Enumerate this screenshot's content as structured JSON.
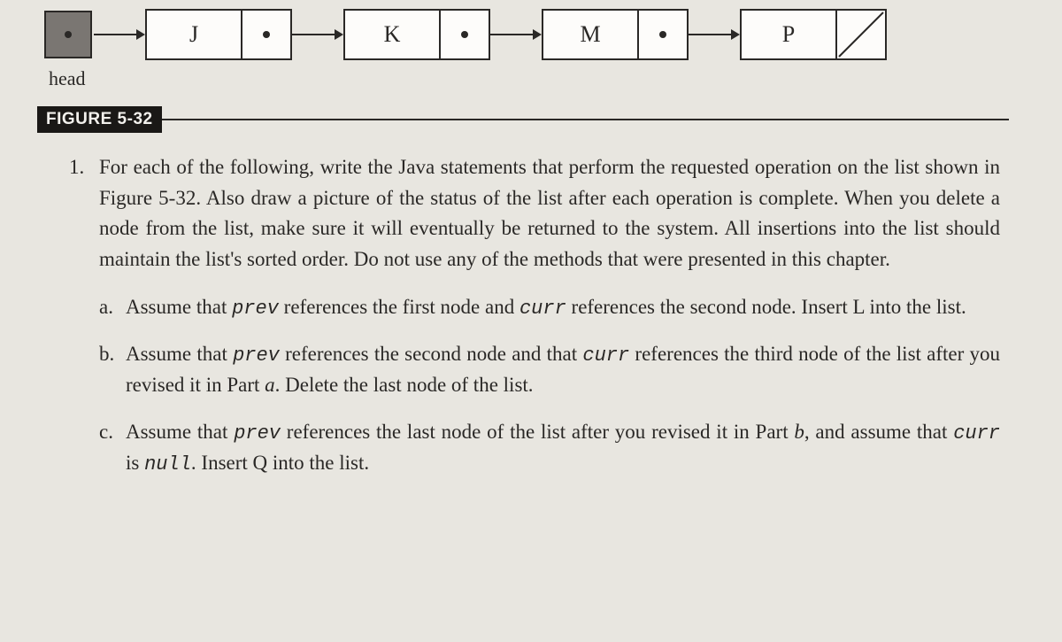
{
  "list": {
    "head_label": "head",
    "nodes": [
      {
        "data": "J",
        "has_next": true
      },
      {
        "data": "K",
        "has_next": true
      },
      {
        "data": "M",
        "has_next": true
      },
      {
        "data": "P",
        "has_next": false
      }
    ]
  },
  "figure_label": "FIGURE 5-32",
  "question": {
    "number": "1.",
    "stem_parts": [
      "For each of the following, write the Java statements that perform the requested operation on the list shown in Figure 5-32. Also draw a picture of the status of the list after each operation is complete. When you delete a node from the list, make sure it will eventually be returned to the system. All insertions into the list should maintain the list's sorted order. Do not use any of the methods that were presented in this chapter."
    ],
    "parts": [
      {
        "marker": "a.",
        "pre": "Assume that ",
        "code1": "prev",
        "mid1": " references the first node and ",
        "code2": "curr",
        "mid2": " references the second node. Insert L into the list.",
        "tail": ""
      },
      {
        "marker": "b.",
        "pre": "Assume that ",
        "code1": "prev",
        "mid1": " references the second node and that ",
        "code2": "curr",
        "mid2": " references the third node of the list after you revised it in Part ",
        "ital": "a",
        "tail": ". Delete the last node of the list."
      },
      {
        "marker": "c.",
        "pre": "Assume that ",
        "code1": "prev",
        "mid1": " references the last node of the list after you revised it in Part ",
        "ital": "b",
        "mid2": ", and assume that ",
        "code2": "curr",
        "mid3": " is ",
        "code3": "null",
        "tail": ". Insert Q into the list."
      }
    ]
  }
}
